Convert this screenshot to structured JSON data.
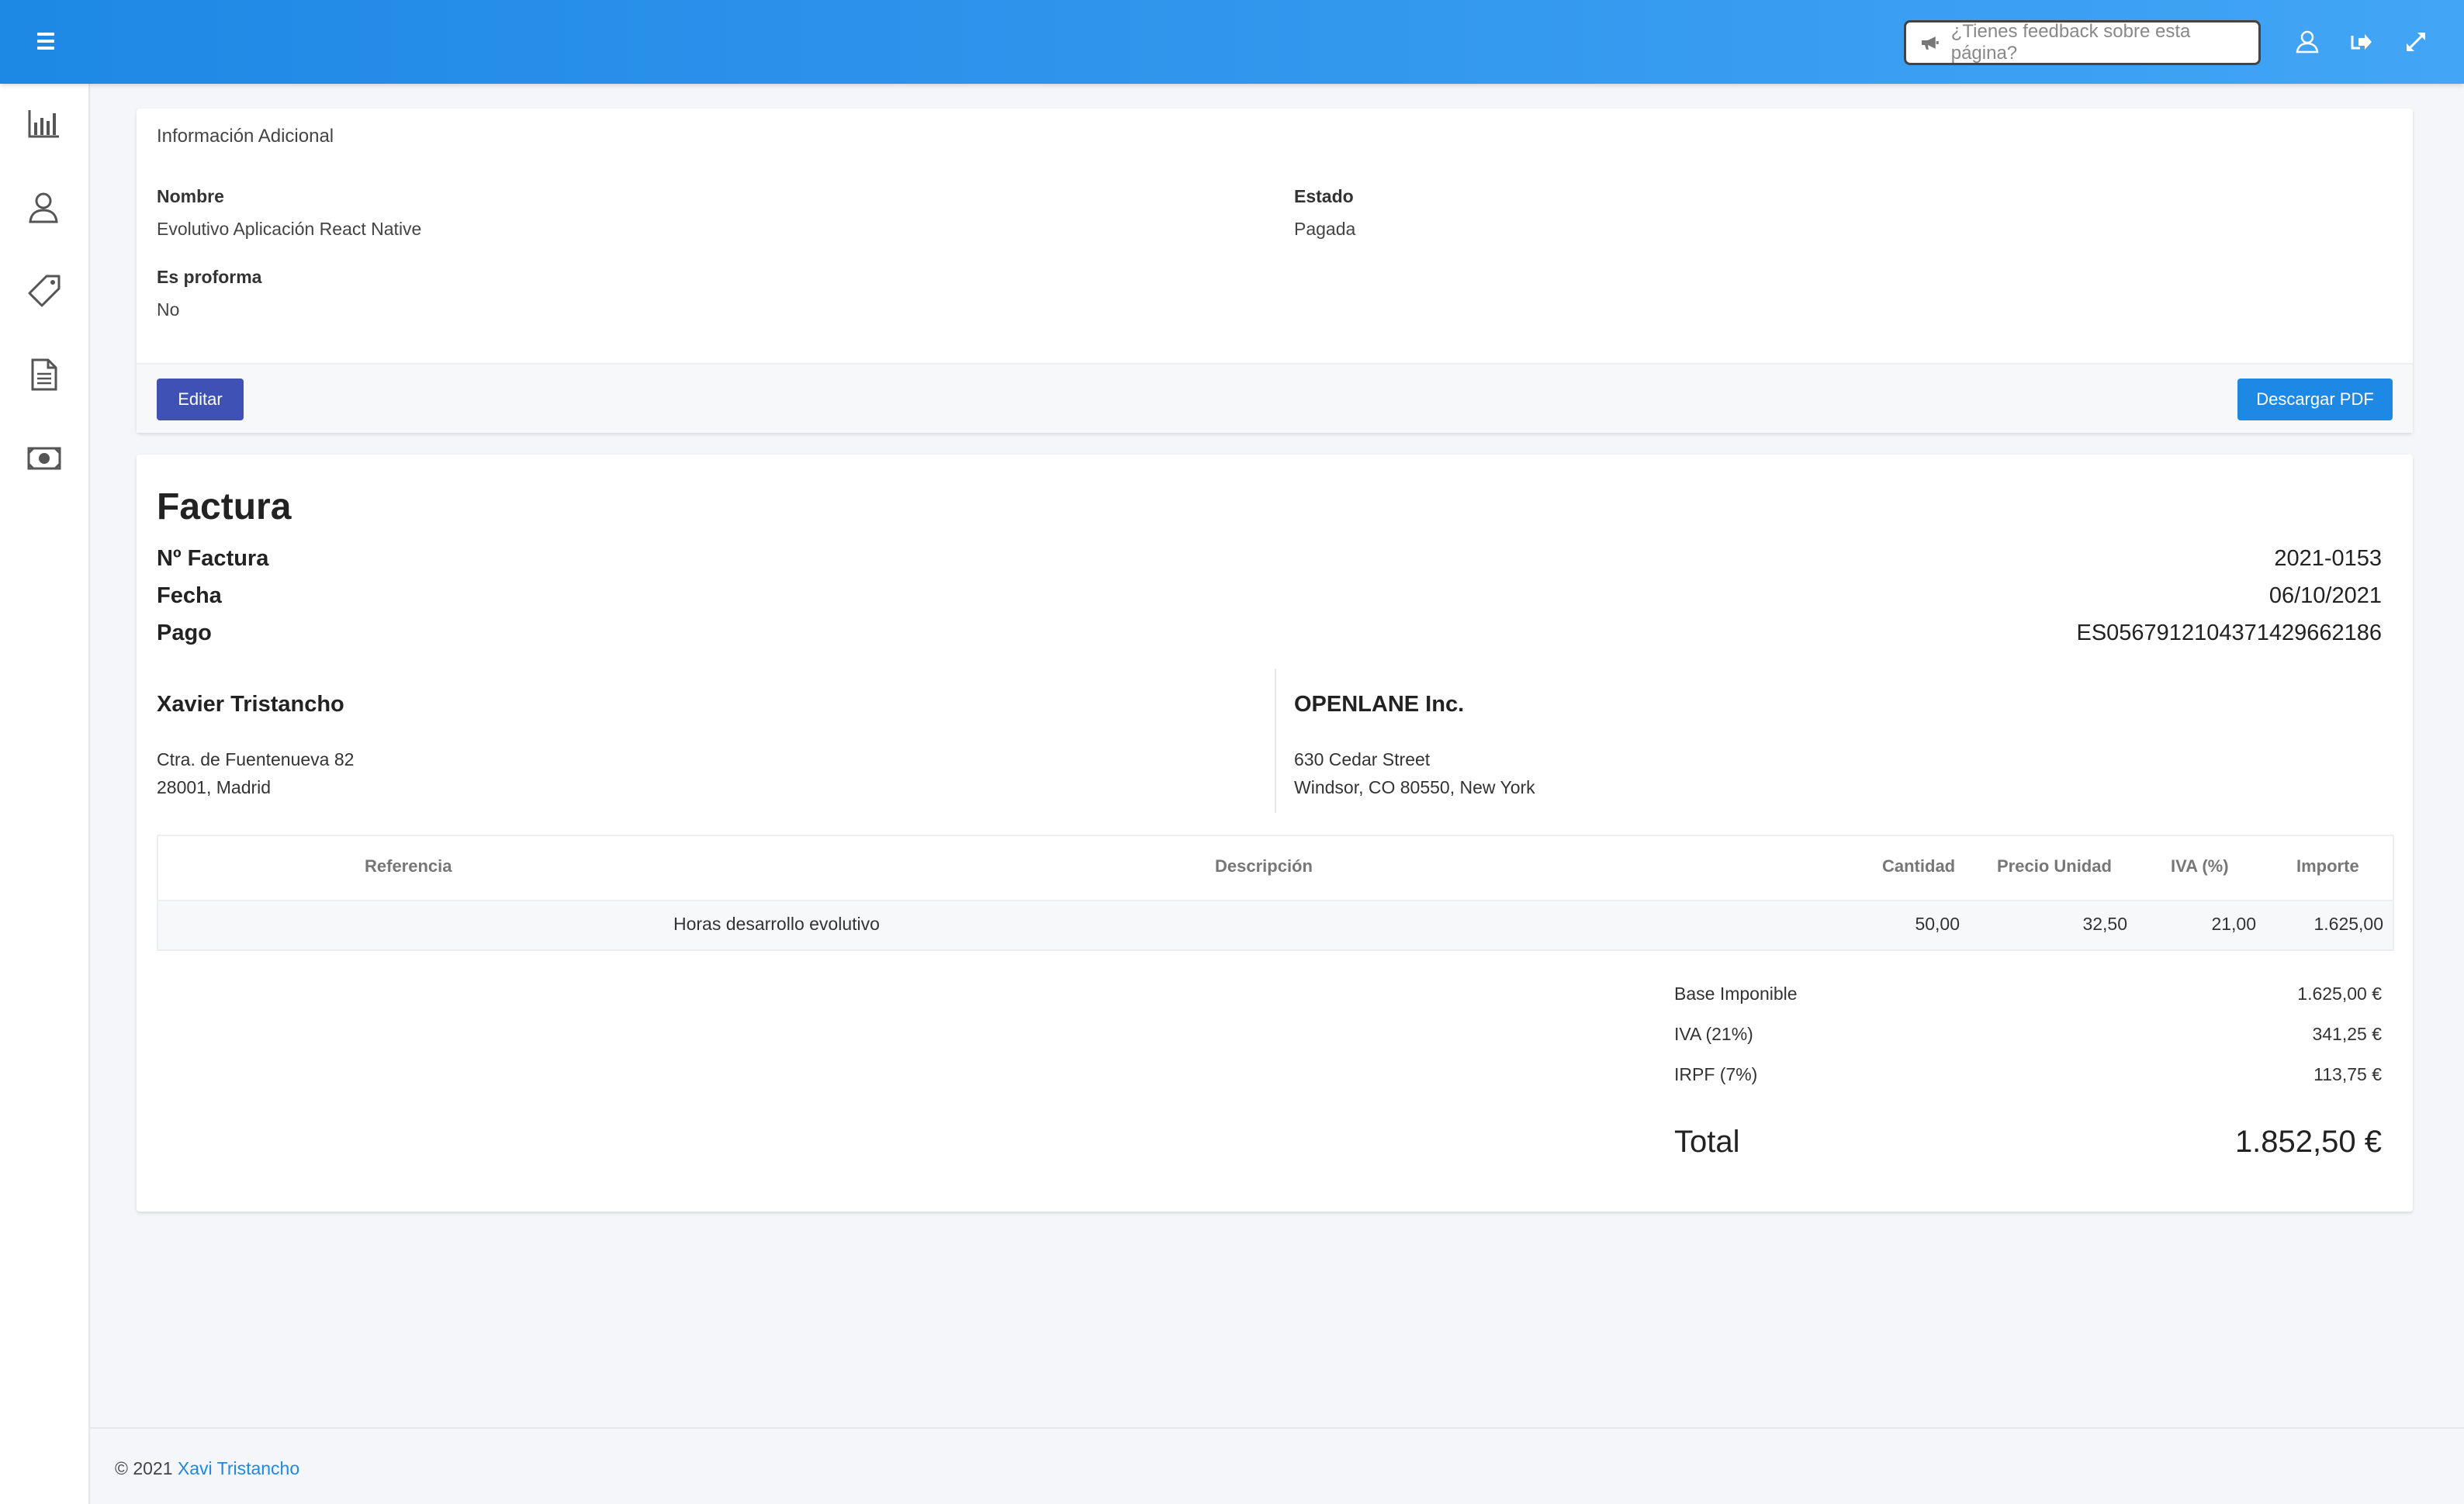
{
  "topbar": {
    "feedback_placeholder": "¿Tienes feedback sobre esta página?",
    "icons": [
      "menu-icon",
      "megaphone-icon",
      "user-icon",
      "logout-icon",
      "fullscreen-icon"
    ],
    "accent_color": "#1e88e5"
  },
  "sidebar": {
    "items": [
      {
        "icon": "chart-icon"
      },
      {
        "icon": "users-icon"
      },
      {
        "icon": "tag-icon"
      },
      {
        "icon": "document-icon"
      },
      {
        "icon": "money-icon"
      }
    ]
  },
  "info": {
    "title": "Información Adicional",
    "nombre_label": "Nombre",
    "nombre_value": "Evolutivo Aplicación React Native",
    "estado_label": "Estado",
    "estado_value": "Pagada",
    "proforma_label": "Es proforma",
    "proforma_value": "No",
    "edit_label": "Editar",
    "pdf_label": "Descargar PDF"
  },
  "invoice": {
    "title": "Factura",
    "numero_label": "Nº Factura",
    "numero_value": "2021-0153",
    "fecha_label": "Fecha",
    "fecha_value": "06/10/2021",
    "pago_label": "Pago",
    "pago_value": "ES0567912104371429662186",
    "emisor": {
      "name": "Xavier Tristancho",
      "line1": "Ctra. de Fuentenueva 82",
      "line2": "28001, Madrid"
    },
    "cliente": {
      "name": "OPENLANE Inc.",
      "line1": "630 Cedar Street",
      "line2": "Windsor, CO 80550, New York"
    },
    "table": {
      "headers": {
        "referencia": "Referencia",
        "descripcion": "Descripción",
        "cantidad": "Cantidad",
        "precio": "Precio Unidad",
        "iva": "IVA (%)",
        "importe": "Importe"
      },
      "rows": [
        {
          "descripcion": "Horas desarrollo evolutivo",
          "cantidad": "50,00",
          "precio": "32,50",
          "iva": "21,00",
          "importe": "1.625,00"
        }
      ]
    },
    "totals": {
      "base_label": "Base Imponible",
      "base_value": "1.625,00 €",
      "iva_label": "IVA (21%)",
      "iva_value": "341,25 €",
      "irpf_label": "IRPF (7%)",
      "irpf_value": "113,75 €",
      "total_label": "Total",
      "total_value": "1.852,50 €"
    }
  },
  "footer": {
    "copyright": "© 2021",
    "author": "Xavi Tristancho"
  }
}
